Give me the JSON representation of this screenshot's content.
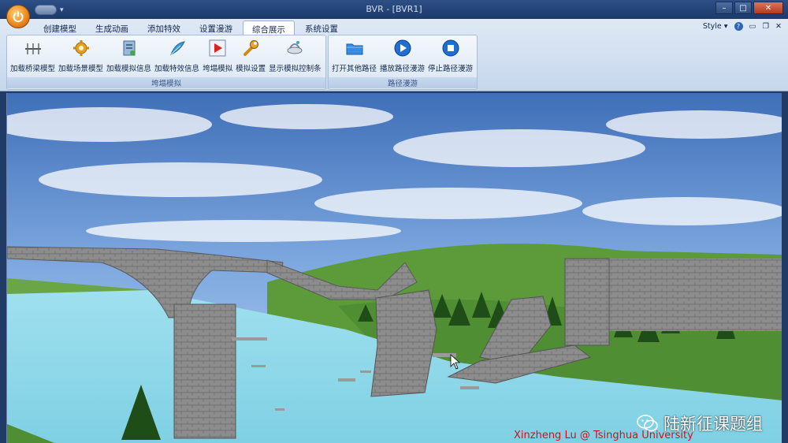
{
  "window": {
    "title": "BVR - [BVR1]"
  },
  "tabs": [
    "创建模型",
    "生成动画",
    "添加特效",
    "设置漫游",
    "综合展示",
    "系统设置"
  ],
  "active_tab": "综合展示",
  "ribbon_right": {
    "style_label": "Style",
    "style_arrow": "▾",
    "help": "?"
  },
  "groups": [
    {
      "label": "垮塌模拟",
      "tools": [
        {
          "label": "加载桥梁模型",
          "icon": "bridge-icon"
        },
        {
          "label": "加载场景模型",
          "icon": "scene-gear-icon"
        },
        {
          "label": "加载模拟信息",
          "icon": "document-icon"
        },
        {
          "label": "加载特效信息",
          "icon": "feather-icon"
        },
        {
          "label": "垮塌模拟",
          "icon": "play-red-icon"
        },
        {
          "label": "模拟设置",
          "icon": "wrench-icon"
        },
        {
          "label": "显示模拟控制条",
          "icon": "satellite-icon"
        }
      ]
    },
    {
      "label": "路径漫游",
      "tools": [
        {
          "label": "打开其他路径",
          "icon": "folder-icon"
        },
        {
          "label": "播放路径漫游",
          "icon": "play-blue-icon"
        },
        {
          "label": "停止路径漫游",
          "icon": "stop-blue-icon"
        }
      ]
    }
  ],
  "watermark": "陆新征课题组",
  "credit": "Xinzheng Lu @ Tsinghua University",
  "colors": {
    "sky": "#5f90d4",
    "water": "#8fd8e8",
    "grass": "#5f9c3c",
    "stone": "#8a8a8a",
    "credit": "#d40f1c"
  }
}
